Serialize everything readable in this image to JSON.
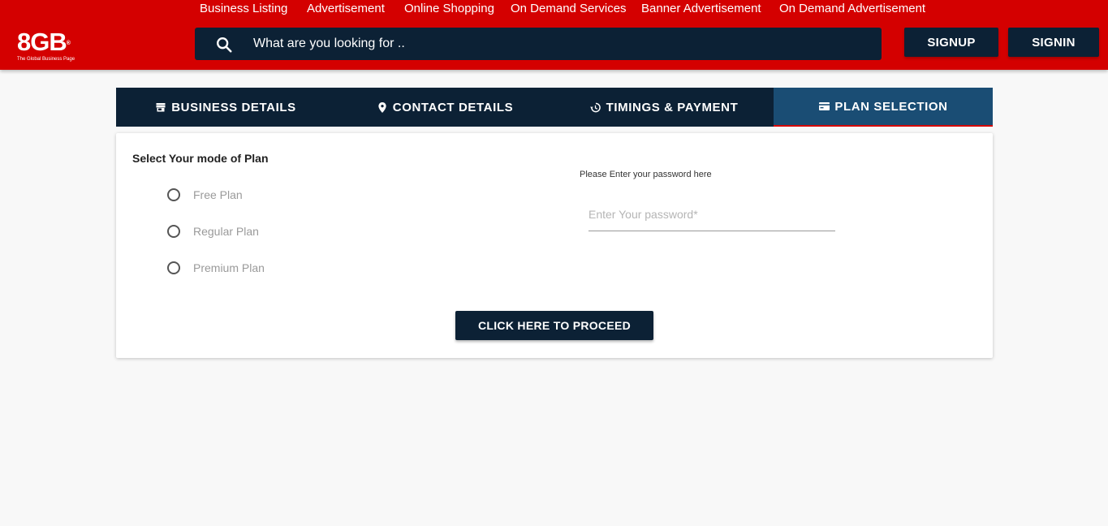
{
  "brand": {
    "logo_text": "8GB",
    "logo_mark": "®",
    "tagline": "The Global Business Page"
  },
  "topnav": [
    "Business Listing",
    "Advertisement",
    "Online Shopping",
    "On Demand Services",
    "Banner Advertisement",
    "On Demand Advertisement"
  ],
  "search": {
    "placeholder": "What are you looking for ..",
    "icon": "search-icon"
  },
  "auth": {
    "signup": "SIGNUP",
    "signin": "SIGNIN"
  },
  "tabs": [
    {
      "label": "BUSINESS DETAILS",
      "icon": "store-icon"
    },
    {
      "label": "CONTACT DETAILS",
      "icon": "location-pin-icon"
    },
    {
      "label": "TIMINGS & PAYMENT",
      "icon": "history-icon"
    },
    {
      "label": "PLAN SELECTION",
      "icon": "card-icon",
      "active": true
    }
  ],
  "form": {
    "heading": "Select Your mode of Plan",
    "plans": [
      "Free Plan",
      "Regular Plan",
      "Premium Plan"
    ],
    "password_label": "Please Enter your password here",
    "password_placeholder": "Enter Your password*",
    "proceed_label": "CLICK HERE TO PROCEED"
  },
  "colors": {
    "header": "#d40000",
    "dark": "#0c2135",
    "active_tab": "#1a4d74",
    "background": "#f8f8f8"
  }
}
